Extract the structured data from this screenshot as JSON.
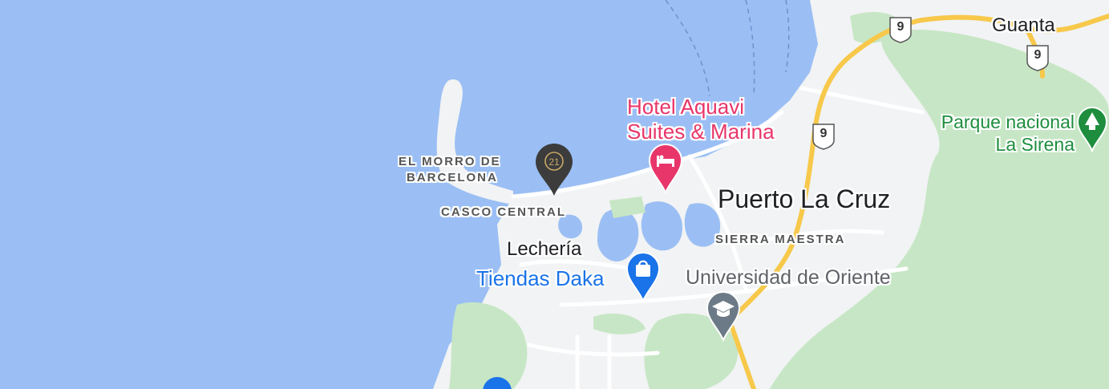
{
  "map": {
    "colors": {
      "water": "#9bbff4",
      "land": "#f1f3f4",
      "park": "#c7e6c5",
      "highway": "#f7c84a",
      "road": "#ffffff",
      "poi_red": "#e8366a",
      "poi_blue": "#1a73e8",
      "poi_gray": "#6b7a86",
      "poi_green": "#1e8e3e",
      "c21_pin": "#3c3c3c"
    },
    "labels": {
      "el_morro_line1": "EL MORRO DE",
      "el_morro_line2": "BARCELONA",
      "casco_central": "CASCO CENTRAL",
      "lecheria": "Lechería",
      "puerto_la_cruz": "Puerto La Cruz",
      "sierra_maestra": "SIERRA MAESTRA",
      "guanta": "Guanta"
    },
    "pois": {
      "hotel_line1": "Hotel Aquavi",
      "hotel_line2": "Suites & Marina",
      "tiendas_daka": "Tiendas Daka",
      "universidad": "Universidad de Oriente",
      "parque_line1": "Parque nacional",
      "parque_line2": "La Sirena",
      "c21_mark": "21"
    },
    "route_shields": {
      "shield_a": "9",
      "shield_b": "9",
      "shield_c": "9"
    },
    "icons": {
      "hotel": "bed-icon",
      "shopping": "shopping-bag-icon",
      "university": "graduation-cap-icon",
      "park": "tree-icon",
      "real_estate": "century21-pin-icon"
    }
  }
}
